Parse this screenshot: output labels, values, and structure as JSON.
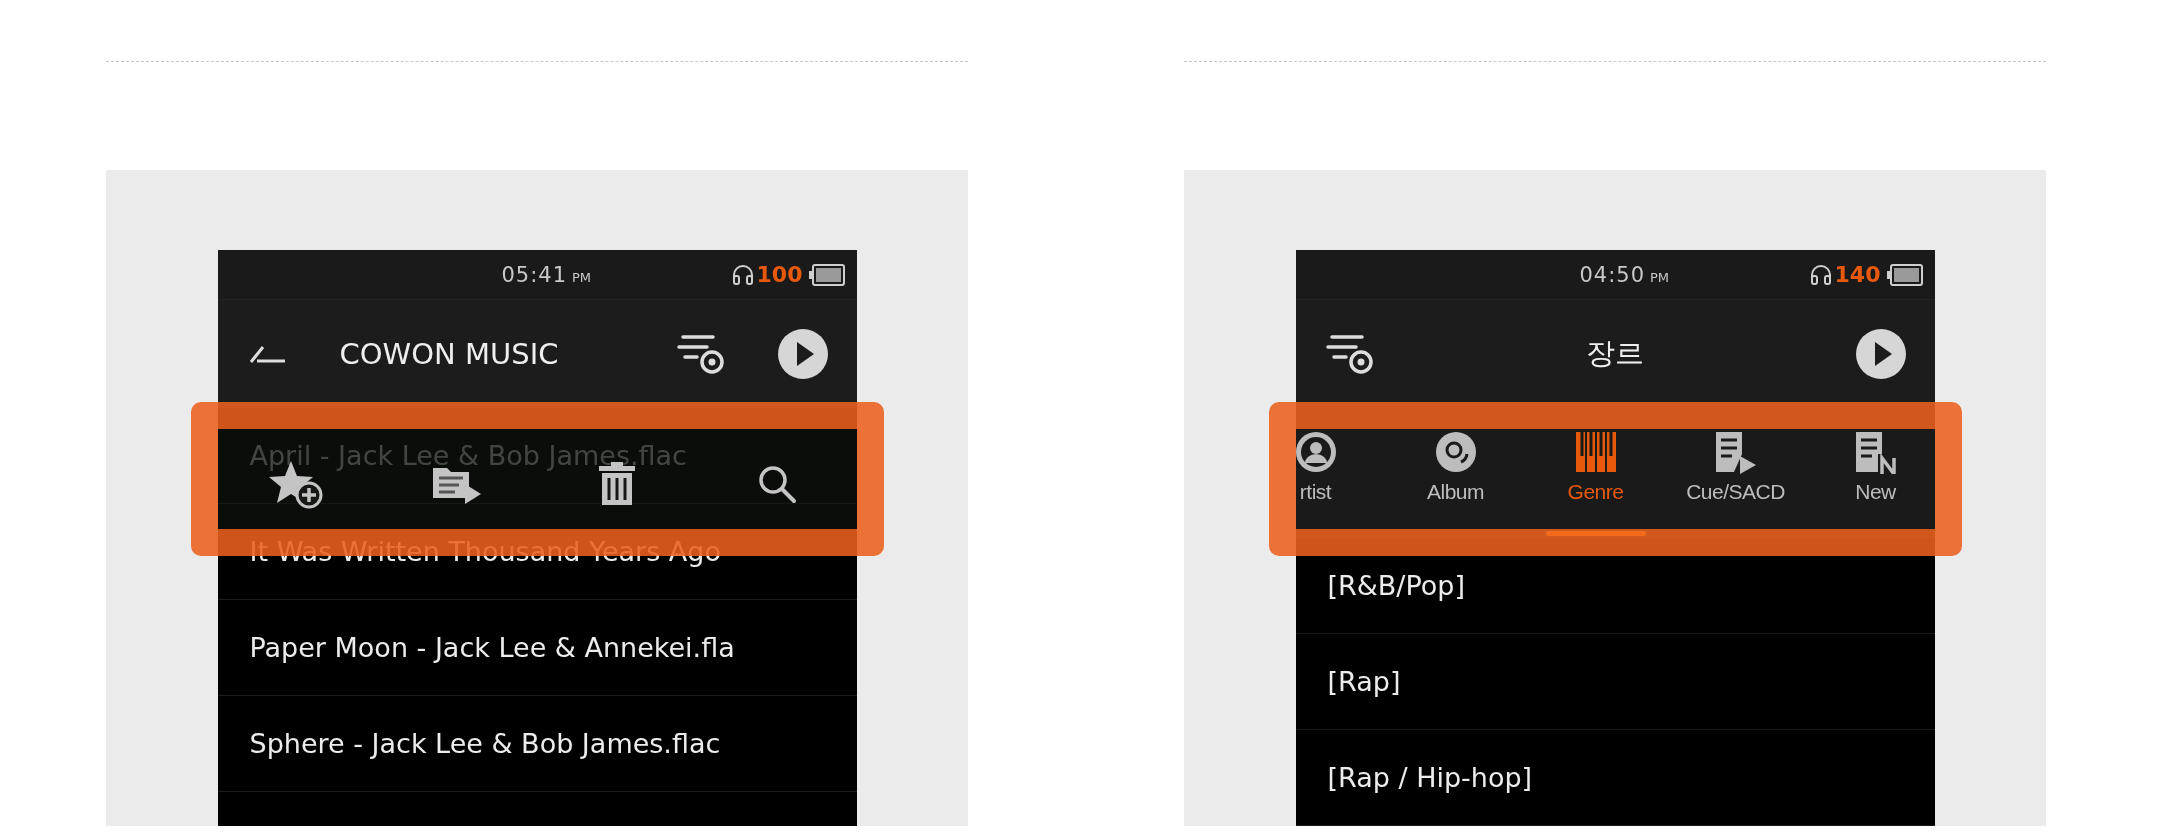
{
  "panels": [
    {
      "kind": "file-list",
      "status": {
        "time": "05:41",
        "meridiem": "PM",
        "volume": "100"
      },
      "header": {
        "title": "COWON MUSIC"
      },
      "rows": [
        {
          "label": "April - Jack Lee & Bob James.flac"
        },
        {
          "label": "It Was Written Thousand Years Ago"
        },
        {
          "label": "Paper Moon - Jack Lee & Annekei.fla"
        },
        {
          "label": "Sphere - Jack Lee & Bob James.flac"
        }
      ]
    },
    {
      "kind": "category-tabs",
      "status": {
        "time": "04:50",
        "meridiem": "PM",
        "volume": "140"
      },
      "header": {
        "title": "장르"
      },
      "tabs": [
        {
          "label": "rtist",
          "kind": "person",
          "selected": false
        },
        {
          "label": "Album",
          "kind": "disc",
          "selected": false
        },
        {
          "label": "Genre",
          "kind": "piano",
          "selected": true
        },
        {
          "label": "Cue/SACD",
          "kind": "list-play",
          "selected": false
        },
        {
          "label": "New",
          "kind": "list-new",
          "selected": false
        }
      ],
      "rows": [
        {
          "label": "[R&B/Pop]"
        },
        {
          "label": "[Rap]"
        },
        {
          "label": "[Rap / Hip-hop]"
        }
      ]
    }
  ]
}
